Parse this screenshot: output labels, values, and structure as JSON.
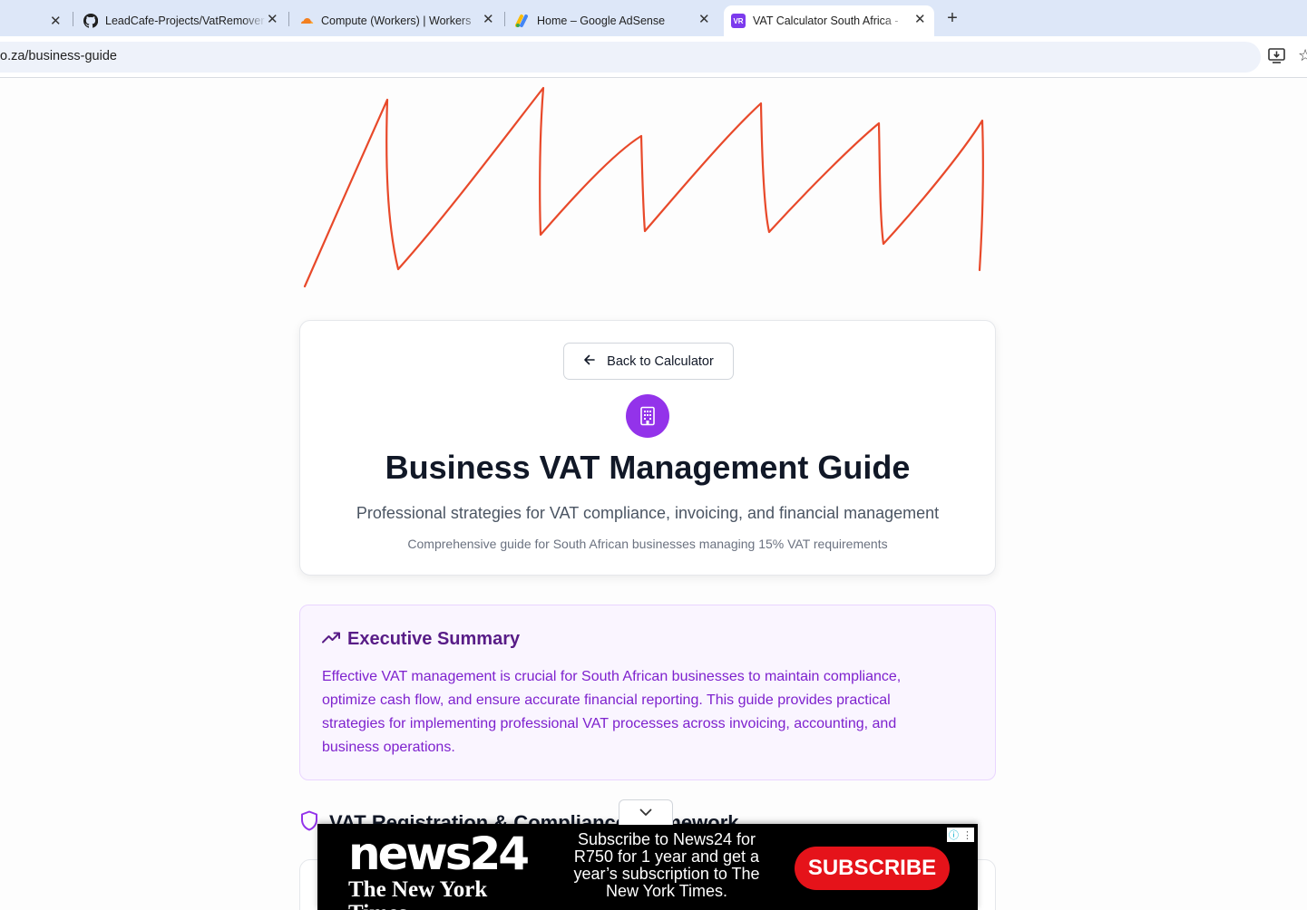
{
  "browser": {
    "tabs": [
      {
        "title": "LeadCafe-Projects/VatRemover",
        "icon": "github-icon"
      },
      {
        "title": "Compute (Workers) | Workers",
        "icon": "cloudflare-icon"
      },
      {
        "title": "Home – Google AdSense",
        "icon": "adsense-icon"
      },
      {
        "title": "VAT Calculator South Africa - ",
        "icon": "vr-icon",
        "favicon_text": "VR",
        "active": true
      }
    ],
    "url": "o.za/business-guide"
  },
  "hero": {
    "back_label": "Back to Calculator",
    "icon": "building-icon",
    "title": "Business VAT Management Guide",
    "subtitle": "Professional strategies for VAT compliance, invoicing, and financial management",
    "note": "Comprehensive guide for South African businesses managing 15% VAT requirements"
  },
  "summary": {
    "icon": "trending-up-icon",
    "title": "Executive Summary",
    "body": "Effective VAT management is crucial for South African businesses to maintain compliance, optimize cash flow, and ensure accurate financial reporting. This guide provides practical strategies for implementing professional VAT processes across invoicing, accounting, and business operations."
  },
  "section": {
    "icon": "shield-icon",
    "title": "VAT Registration & Compliance Framework"
  },
  "ad": {
    "brand": "news24",
    "partner": "The New York Times",
    "copy": "Subscribe to News24 for R750 for 1 year and get a year’s subscription to The New York Times.",
    "cta": "SUBSCRIBE"
  },
  "colors": {
    "accent": "#9333ea",
    "summary_bg": "#faf5ff",
    "summary_text": "#7e22ce",
    "annotation": "#e8492a",
    "ad_cta": "#e5131a"
  }
}
